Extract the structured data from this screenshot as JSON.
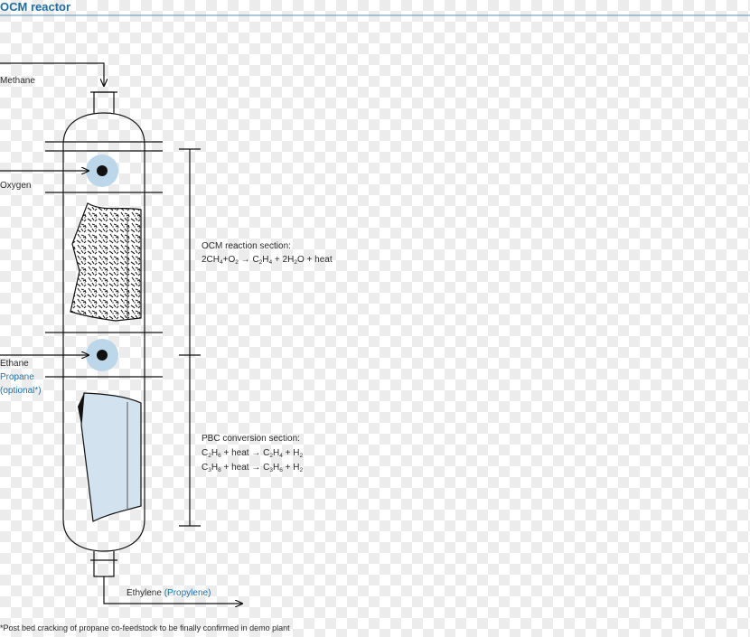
{
  "title": "OCM reactor",
  "inputs": {
    "methane": "Methane",
    "oxygen": "Oxygen",
    "ethane": "Ethane",
    "propane": "Propane",
    "optional": "(optional*)"
  },
  "output": {
    "ethylene": "Ethylene",
    "propylene": "(Propylene)"
  },
  "ocm_section": {
    "title": "OCM reaction section:",
    "equation": "2CH4+O2 → C2H4 + 2H2O + heat"
  },
  "pbc_section": {
    "title": "PBC conversion section:",
    "equation1": "C2H6 + heat → C2H4 + H2",
    "equation2": "C3H8 + heat → C3H6 + H2"
  },
  "footnote": "*Post bed cracking of propane co-feedstock to be finally confirmed in demo plant",
  "colors": {
    "accent": "#1f6fa3",
    "bed_light": "#d2e2ee",
    "nozzle_glow": "#bcd7ea"
  }
}
